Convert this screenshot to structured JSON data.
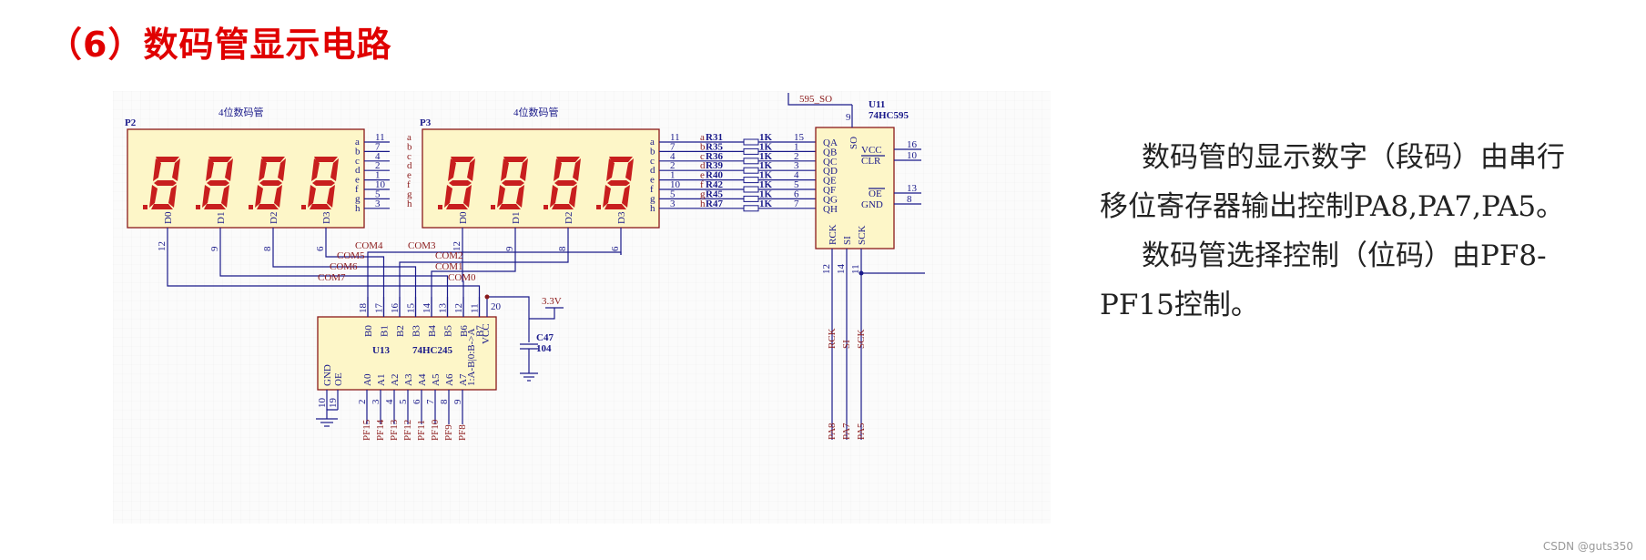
{
  "title": "（6）数码管显示电路",
  "description": {
    "para1_line1": "数码管的显示数字（段码）由串行",
    "para1_line2": "移位寄存器输出控制PA8,PA7,PA5。",
    "para2_line1": "数码管选择控制（位码）由PF8-",
    "para2_line2": "PF15控制。"
  },
  "watermark": "CSDN @guts350",
  "schematic": {
    "p2": {
      "designator": "P2",
      "label": "4位数码管"
    },
    "p3": {
      "designator": "P3",
      "label": "4位数码管"
    },
    "seg_pins": [
      "a",
      "b",
      "c",
      "d",
      "e",
      "f",
      "g",
      "h"
    ],
    "seg_pin_numbers": [
      "11",
      "7",
      "4",
      "2",
      "1",
      "10",
      "5",
      "3"
    ],
    "digit_pins": [
      "D0",
      "D1",
      "D2",
      "D3"
    ],
    "p2_digit_numbers": [
      "12",
      "9",
      "8",
      "6"
    ],
    "p3_digit_numbers": [
      "12",
      "9",
      "8",
      "6"
    ],
    "resistors": [
      "R31",
      "R35",
      "R36",
      "R39",
      "R40",
      "R42",
      "R45",
      "R47"
    ],
    "resistor_value": "1K",
    "u11": {
      "designator": "U11",
      "part": "74HC595",
      "outputs": [
        "QA",
        "QB",
        "QC",
        "QD",
        "QE",
        "QF",
        "QG",
        "QH"
      ],
      "output_pins": [
        "15",
        "1",
        "2",
        "3",
        "4",
        "5",
        "6",
        "7"
      ],
      "so": "SO",
      "so_pin": "9",
      "so_net": "595_SO",
      "vcc": "VCC",
      "vcc_pin": "16",
      "clr": "CLR",
      "clr_pin": "10",
      "oe": "OE",
      "oe_pin": "13",
      "gnd": "GND",
      "gnd_pin": "8",
      "bottom_pins": [
        "RCK",
        "SI",
        "SCK"
      ],
      "bottom_pin_numbers": [
        "12",
        "14",
        "11"
      ],
      "bottom_nets": [
        "PA8",
        "PA7",
        "PA5"
      ]
    },
    "coms": [
      "COM4",
      "COM3",
      "COM5",
      "COM2",
      "COM6",
      "COM1",
      "COM7",
      "COM0"
    ],
    "u13": {
      "designator": "U13",
      "part": "74HC245",
      "b_pins": [
        "B0",
        "B1",
        "B2",
        "B3",
        "B4",
        "B5",
        "B6",
        "B7"
      ],
      "b_pin_numbers": [
        "18",
        "17",
        "16",
        "15",
        "14",
        "13",
        "12",
        "11"
      ],
      "a_pins": [
        "A0",
        "A1",
        "A2",
        "A3",
        "A4",
        "A5",
        "A6",
        "A7"
      ],
      "a_pin_numbers": [
        "2",
        "3",
        "4",
        "5",
        "6",
        "7",
        "8",
        "9"
      ],
      "a_nets": [
        "PF15",
        "PF14",
        "PF13",
        "PF12",
        "PF11",
        "PF10",
        "PF9",
        "PF8"
      ],
      "gnd": "GND",
      "gnd_pin": "10",
      "oe": "OE",
      "oe_pin": "19",
      "dir": "1:A-B|0:B->A",
      "dir_pin": "1",
      "vcc": "VCC",
      "vcc_pin": "20"
    },
    "cap": {
      "designator": "C47",
      "value": "104"
    },
    "supply": "3.3V"
  }
}
